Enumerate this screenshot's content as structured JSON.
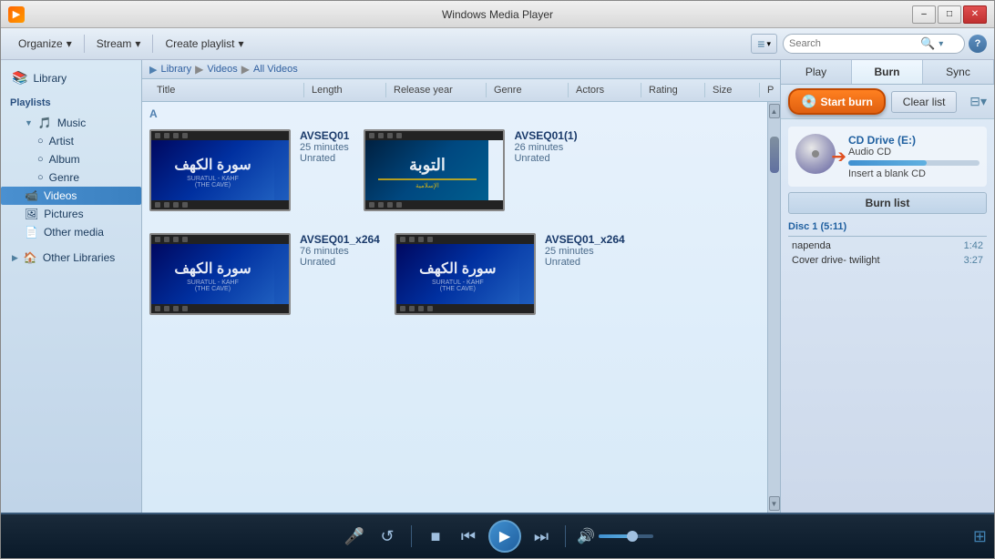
{
  "titlebar": {
    "title": "Windows Media Player",
    "icon": "▶",
    "min_label": "–",
    "max_label": "□",
    "close_label": "✕"
  },
  "breadcrumb": {
    "items": [
      "Library",
      "Videos",
      "All Videos"
    ]
  },
  "toolbar": {
    "organize_label": "Organize",
    "stream_label": "Stream",
    "create_playlist_label": "Create playlist",
    "search_placeholder": "Search",
    "help_label": "?"
  },
  "tabs": {
    "play_label": "Play",
    "burn_label": "Burn",
    "sync_label": "Sync"
  },
  "sidebar": {
    "library_label": "Library",
    "playlists_label": "Playlists",
    "music_label": "Music",
    "artist_label": "Artist",
    "album_label": "Album",
    "genre_label": "Genre",
    "videos_label": "Videos",
    "pictures_label": "Pictures",
    "other_media_label": "Other media",
    "other_libraries_label": "Other Libraries"
  },
  "library": {
    "columns": [
      "Title",
      "Length",
      "Release year",
      "Genre",
      "Actors",
      "Rating",
      "Size",
      "P"
    ],
    "section_letter": "A",
    "videos": [
      {
        "id": "v1",
        "title": "AVSEQ01",
        "duration": "25 minutes",
        "rating": "Unrated",
        "bg": "1",
        "arabic_text": "سورة الكهف",
        "sub_text": "SURATUL - KAHF\n(THE CAVE)"
      },
      {
        "id": "v2",
        "title": "AVSEQ01(1)",
        "duration": "26 minutes",
        "rating": "Unrated",
        "bg": "2",
        "arabic_text": "التوبة",
        "sub_text": ""
      },
      {
        "id": "v3",
        "title": "AVSEQ01_x264",
        "duration": "76 minutes",
        "rating": "Unrated",
        "bg": "1",
        "arabic_text": "سورة الكهف",
        "sub_text": "SURATUL - KAHF\n(THE CAVE)"
      },
      {
        "id": "v4",
        "title": "AVSEQ01_x264",
        "duration": "25 minutes",
        "rating": "Unrated",
        "bg": "1",
        "arabic_text": "سورة الكهف",
        "sub_text": "SURATUL - KAHF\n(THE CAVE)"
      }
    ]
  },
  "right_panel": {
    "cd_drive": "CD Drive (E:)",
    "cd_type": "Audio CD",
    "cd_insert": "Insert a blank CD",
    "start_burn_label": "Start burn",
    "clear_list_label": "Clear list",
    "burn_list_label": "Burn list",
    "disc_label": "Disc 1 (5:11)",
    "tracks": [
      {
        "name": "napenda",
        "time": "1:42"
      },
      {
        "name": "Cover drive- twilight",
        "time": "3:27"
      }
    ]
  },
  "player": {
    "mic_icon": "🎤",
    "repeat_icon": "↺",
    "stop_icon": "■",
    "prev_icon": "⏮",
    "play_icon": "▶",
    "next_icon": "⏭",
    "volume_icon": "🔊",
    "grid_icon": "⊞"
  }
}
